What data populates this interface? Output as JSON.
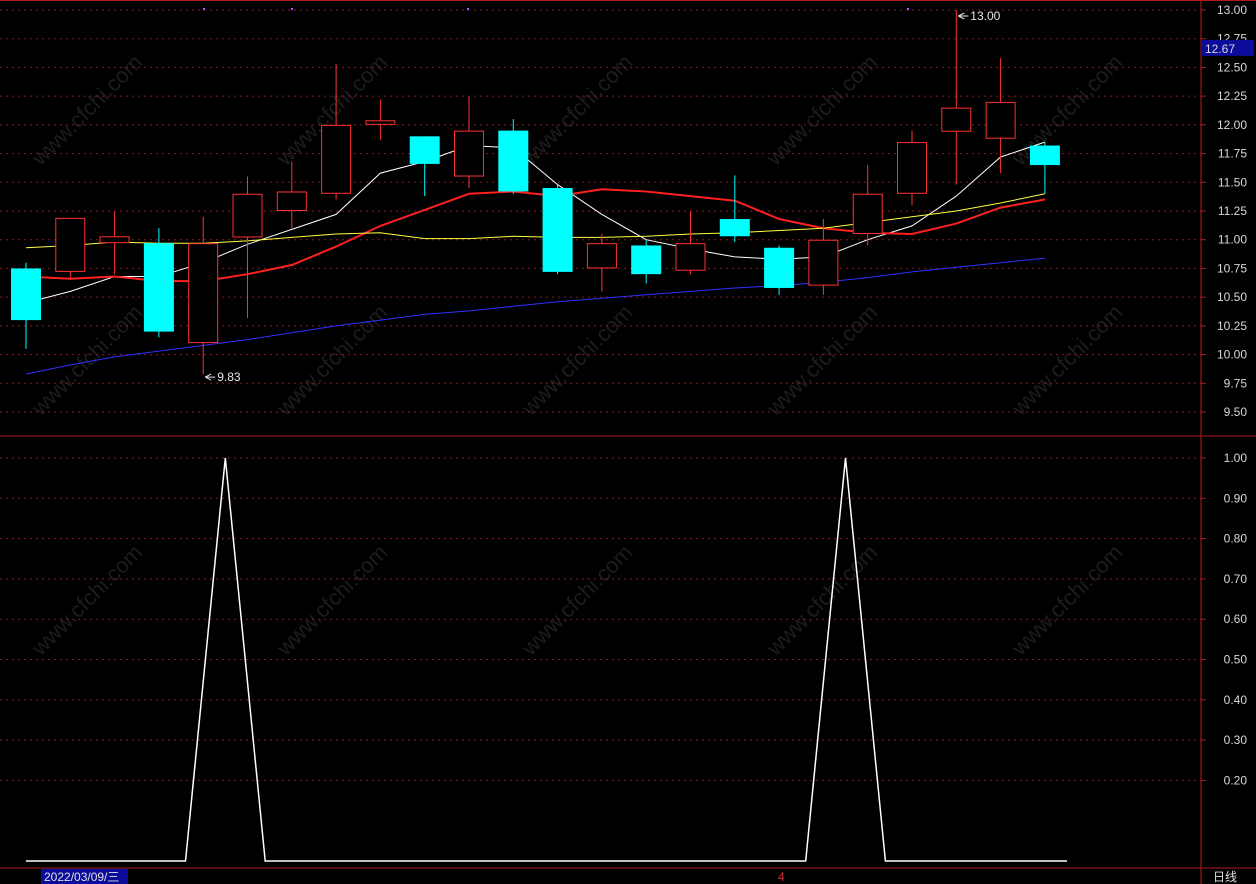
{
  "chart_data": [
    {
      "type": "candlestick",
      "y_ticks": [
        "13.00",
        "12.75",
        "12.50",
        "12.25",
        "12.00",
        "11.75",
        "11.50",
        "11.25",
        "11.00",
        "10.75",
        "10.50",
        "10.25",
        "10.00",
        "9.75",
        "9.50"
      ],
      "ylim": [
        9.35,
        13.05
      ],
      "current_price_label": "12.67",
      "high_annotation": "13.00",
      "low_annotation": "9.83",
      "candles": [
        {
          "o": 10.75,
          "h": 10.8,
          "l": 10.05,
          "c": 10.3
        },
        {
          "o": 10.72,
          "h": 11.0,
          "l": 10.65,
          "c": 11.19
        },
        {
          "o": 10.97,
          "h": 11.25,
          "l": 10.7,
          "c": 11.03
        },
        {
          "o": 10.97,
          "h": 11.1,
          "l": 10.15,
          "c": 10.2
        },
        {
          "o": 10.1,
          "h": 11.2,
          "l": 9.83,
          "c": 10.97
        },
        {
          "o": 11.02,
          "h": 11.55,
          "l": 10.32,
          "c": 11.4
        },
        {
          "o": 11.25,
          "h": 11.68,
          "l": 11.1,
          "c": 11.42
        },
        {
          "o": 11.4,
          "h": 12.53,
          "l": 11.35,
          "c": 12.0
        },
        {
          "o": 12.0,
          "h": 12.22,
          "l": 11.87,
          "c": 12.04
        },
        {
          "o": 11.9,
          "h": 11.9,
          "l": 11.38,
          "c": 11.66
        },
        {
          "o": 11.55,
          "h": 12.25,
          "l": 11.45,
          "c": 11.95
        },
        {
          "o": 11.95,
          "h": 12.05,
          "l": 11.4,
          "c": 11.42
        },
        {
          "o": 11.45,
          "h": 11.48,
          "l": 10.7,
          "c": 10.72
        },
        {
          "o": 10.75,
          "h": 11.05,
          "l": 10.55,
          "c": 10.97
        },
        {
          "o": 10.95,
          "h": 11.0,
          "l": 10.62,
          "c": 10.7
        },
        {
          "o": 10.73,
          "h": 11.25,
          "l": 10.7,
          "c": 10.97
        },
        {
          "o": 11.18,
          "h": 11.56,
          "l": 10.98,
          "c": 11.03
        },
        {
          "o": 10.93,
          "h": 10.95,
          "l": 10.52,
          "c": 10.58
        },
        {
          "o": 10.6,
          "h": 11.18,
          "l": 10.52,
          "c": 11.0
        },
        {
          "o": 11.05,
          "h": 11.65,
          "l": 10.95,
          "c": 11.4
        },
        {
          "o": 11.4,
          "h": 11.95,
          "l": 11.3,
          "c": 11.85
        },
        {
          "o": 11.94,
          "h": 13.0,
          "l": 11.48,
          "c": 12.15
        },
        {
          "o": 11.88,
          "h": 12.58,
          "l": 11.58,
          "c": 12.2
        },
        {
          "o": 11.82,
          "h": 11.85,
          "l": 11.4,
          "c": 11.65
        }
      ],
      "ma_series": [
        {
          "color": "#ffffff",
          "values": [
            10.45,
            10.55,
            10.68,
            10.68,
            10.8,
            10.96,
            11.09,
            11.22,
            11.58,
            11.68,
            11.82,
            11.8,
            11.48,
            11.22,
            11.0,
            10.92,
            10.85,
            10.83,
            10.85,
            11.0,
            11.12,
            11.38,
            11.72,
            11.85
          ]
        },
        {
          "color": "#ff2020",
          "values": [
            10.68,
            10.66,
            10.68,
            10.64,
            10.64,
            10.7,
            10.78,
            10.94,
            11.12,
            11.26,
            11.4,
            11.42,
            11.38,
            11.44,
            11.42,
            11.38,
            11.34,
            11.18,
            11.1,
            11.06,
            11.05,
            11.14,
            11.28,
            11.35
          ]
        },
        {
          "color": "#ffff40",
          "values": [
            10.93,
            10.95,
            10.98,
            10.97,
            10.97,
            10.99,
            11.02,
            11.05,
            11.06,
            11.01,
            11.01,
            11.03,
            11.02,
            11.02,
            11.03,
            11.05,
            11.06,
            11.08,
            11.1,
            11.15,
            11.2,
            11.25,
            11.32,
            11.4
          ]
        },
        {
          "color": "#3030ff",
          "values": [
            9.83,
            9.91,
            9.98,
            10.03,
            10.08,
            10.13,
            10.19,
            10.25,
            10.3,
            10.35,
            10.38,
            10.42,
            10.46,
            10.49,
            10.52,
            10.55,
            10.58,
            10.6,
            10.63,
            10.67,
            10.72,
            10.76,
            10.8,
            10.84
          ]
        }
      ]
    },
    {
      "type": "line",
      "y_ticks": [
        "1.00",
        "0.90",
        "0.80",
        "0.70",
        "0.60",
        "0.50",
        "0.40",
        "0.30",
        "0.20"
      ],
      "ylim": [
        0,
        1.05
      ],
      "series": [
        {
          "color": "#ffffff",
          "points": [
            [
              0,
              0
            ],
            [
              3.6,
              0
            ],
            [
              4.5,
              1
            ],
            [
              5.4,
              0
            ],
            [
              17.6,
              0
            ],
            [
              18.5,
              1
            ],
            [
              19.4,
              0
            ],
            [
              23.5,
              0
            ]
          ]
        }
      ]
    }
  ],
  "bottom_bar": {
    "date_label": "2022/03/09/三",
    "month_marker": "4",
    "period_label": "日线"
  },
  "watermark": "www.cfchi.com"
}
